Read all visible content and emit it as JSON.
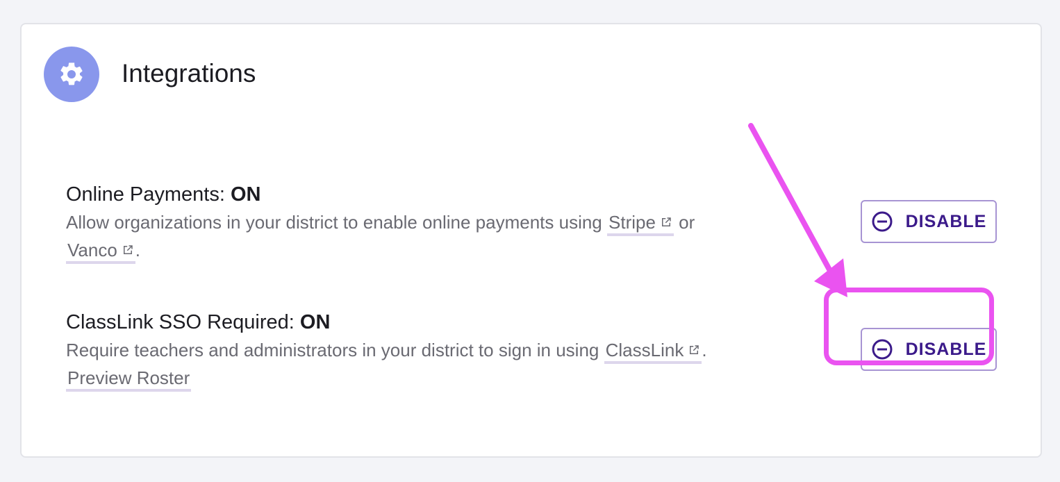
{
  "header": {
    "title": "Integrations",
    "icon": "gear-icon",
    "icon_bg": "#8997ec"
  },
  "integrations": [
    {
      "title": "Online Payments:",
      "status": "ON",
      "desc_prefix": "Allow organizations in your district to enable online payments using",
      "link1": "Stripe",
      "desc_mid": "or",
      "link2": "Vanco",
      "desc_suffix": ".",
      "button_label": "DISABLE"
    },
    {
      "title": "ClassLink SSO Required:",
      "status": "ON",
      "desc_prefix": "Require teachers and administrators in your district to sign in using",
      "link1": "ClassLink",
      "desc_suffix": ".",
      "extra_link": "Preview Roster",
      "button_label": "DISABLE"
    }
  ],
  "colors": {
    "accent": "#3b1a8a",
    "annotation": "#ea53f0"
  }
}
